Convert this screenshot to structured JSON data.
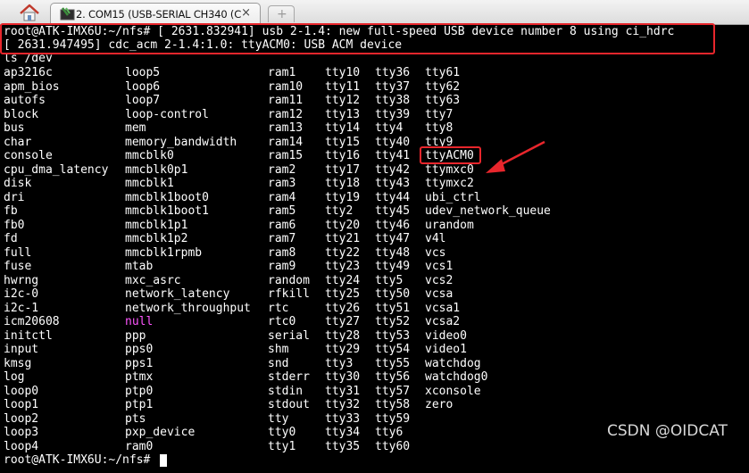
{
  "tab": {
    "label": "2. COM15  (USB-SERIAL CH340 (C",
    "close_glyph": "×",
    "new_tab_glyph": "+"
  },
  "terminal": {
    "lines": [
      "root@ATK-IMX6U:~/nfs# [ 2631.832941] usb 2-1.4: new full-speed USB device number 8 using ci_hdrc",
      "[ 2631.947495] cdc_acm 2-1.4:1.0: ttyACM0: USB ACM device",
      "ls /dev"
    ],
    "listing": {
      "col1": [
        "ap3216c",
        "apm_bios",
        "autofs",
        "block",
        "bus",
        "char",
        "console",
        "cpu_dma_latency",
        "disk",
        "dri",
        "fb",
        "fb0",
        "fd",
        "full",
        "fuse",
        "hwrng",
        "i2c-0",
        "i2c-1",
        "icm20608",
        "initctl",
        "input",
        "kmsg",
        "log",
        "loop0",
        "loop1",
        "loop2",
        "loop3",
        "loop4"
      ],
      "col2": [
        "loop5",
        "loop6",
        "loop7",
        "loop-control",
        "mem",
        "memory_bandwidth",
        "mmcblk0",
        "mmcblk0p1",
        "mmcblk1",
        "mmcblk1boot0",
        "mmcblk1boot1",
        "mmcblk1p1",
        "mmcblk1p2",
        "mmcblk1rpmb",
        "mtab",
        "mxc_asrc",
        "network_latency",
        "network_throughput",
        "null",
        "ppp",
        "pps0",
        "pps1",
        "ptmx",
        "ptp0",
        "ptp1",
        "pts",
        "pxp_device",
        "ram0"
      ],
      "col3": [
        "ram1",
        "ram10",
        "ram11",
        "ram12",
        "ram13",
        "ram14",
        "ram15",
        "ram2",
        "ram3",
        "ram4",
        "ram5",
        "ram6",
        "ram7",
        "ram8",
        "ram9",
        "random",
        "rfkill",
        "rtc",
        "rtc0",
        "serial",
        "shm",
        "snd",
        "stderr",
        "stdin",
        "stdout",
        "tty",
        "tty0",
        "tty1"
      ],
      "col4": [
        "tty10",
        "tty11",
        "tty12",
        "tty13",
        "tty14",
        "tty15",
        "tty16",
        "tty17",
        "tty18",
        "tty19",
        "tty2",
        "tty20",
        "tty21",
        "tty22",
        "tty23",
        "tty24",
        "tty25",
        "tty26",
        "tty27",
        "tty28",
        "tty29",
        "tty3",
        "tty30",
        "tty31",
        "tty32",
        "tty33",
        "tty34",
        "tty35"
      ],
      "col5": [
        "tty36",
        "tty37",
        "tty38",
        "tty39",
        "tty4",
        "tty40",
        "tty41",
        "tty42",
        "tty43",
        "tty44",
        "tty45",
        "tty46",
        "tty47",
        "tty48",
        "tty49",
        "tty5",
        "tty50",
        "tty51",
        "tty52",
        "tty53",
        "tty54",
        "tty55",
        "tty56",
        "tty57",
        "tty58",
        "tty59",
        "tty6",
        "tty60"
      ],
      "col6": [
        "tty61",
        "tty62",
        "tty63",
        "tty7",
        "tty8",
        "tty9",
        "ttyACM0",
        "ttymxc0",
        "ttymxc2",
        "ubi_ctrl",
        "udev_network_queue",
        "urandom",
        "v4l",
        "vcs",
        "vcs1",
        "vcs2",
        "vcsa",
        "vcsa1",
        "vcsa2",
        "video0",
        "video1",
        "watchdog",
        "watchdog0",
        "xconsole",
        "zero"
      ]
    },
    "prompt": "root@ATK-IMX6U:~/nfs# "
  },
  "watermark": "CSDN @OIDCAT",
  "colors": {
    "highlight": "#e8262c",
    "special_file": "#ff55ff",
    "text": "#ffffff",
    "background": "#000000"
  },
  "icons": {
    "home": "home-icon",
    "terminal": "terminal-tab-icon",
    "annotation": "arrow-icon"
  }
}
